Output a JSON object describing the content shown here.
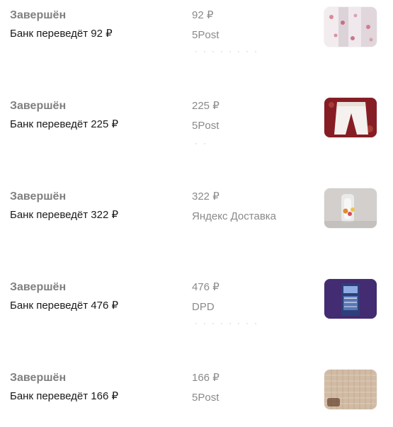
{
  "orders": [
    {
      "status": "Завершён",
      "payout": "Банк переведёт 92 ₽",
      "price": "92 ₽",
      "carrier": "5Post",
      "thumbnail": "curtains-photo"
    },
    {
      "status": "Завершён",
      "payout": "Банк переведёт 225 ₽",
      "price": "225 ₽",
      "carrier": "5Post",
      "thumbnail": "white-pants-photo"
    },
    {
      "status": "Завершён",
      "payout": "Банк переведёт 322 ₽",
      "price": "322 ₽",
      "carrier": "Яндекс Доставка",
      "thumbnail": "vase-flowers-photo"
    },
    {
      "status": "Завершён",
      "payout": "Банк переведёт 476 ₽",
      "price": "476 ₽",
      "carrier": "DPD",
      "thumbnail": "book-cover-photo"
    },
    {
      "status": "Завершён",
      "payout": "Банк переведёт 166 ₽",
      "price": "166 ₽",
      "carrier": "5Post",
      "thumbnail": "lace-curtain-photo"
    }
  ]
}
